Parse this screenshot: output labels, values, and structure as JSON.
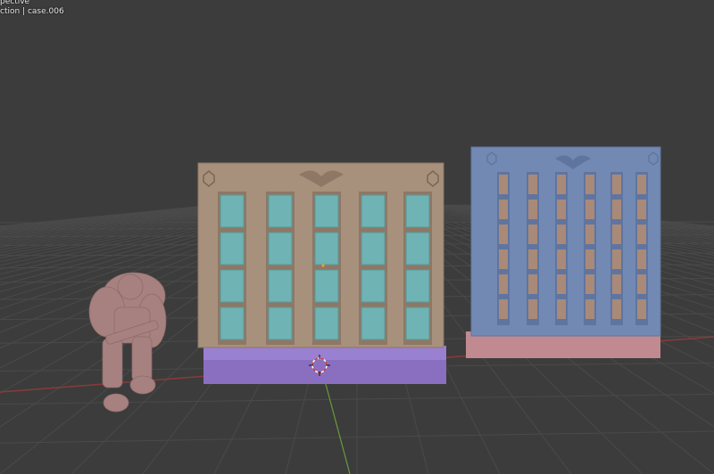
{
  "viewport": {
    "view_mode": "pective",
    "collection_object": "ction | case.006"
  },
  "objects": [
    {
      "name": "miniature",
      "color": "#a7817f"
    },
    {
      "name": "tan-rack-wall",
      "color": "#a7917d",
      "slot_color": "#6fb3b4",
      "base_color": "#8a6fc0"
    },
    {
      "name": "blue-rack-wall",
      "color": "#7289b3",
      "slot_color": "#a98a78",
      "base_color": "#c08a90"
    }
  ],
  "colors": {
    "background": "#3c3c3c",
    "grid": "#4a4a4a",
    "x_axis": "#8a3a3a",
    "y_axis": "#6a9a3a"
  }
}
